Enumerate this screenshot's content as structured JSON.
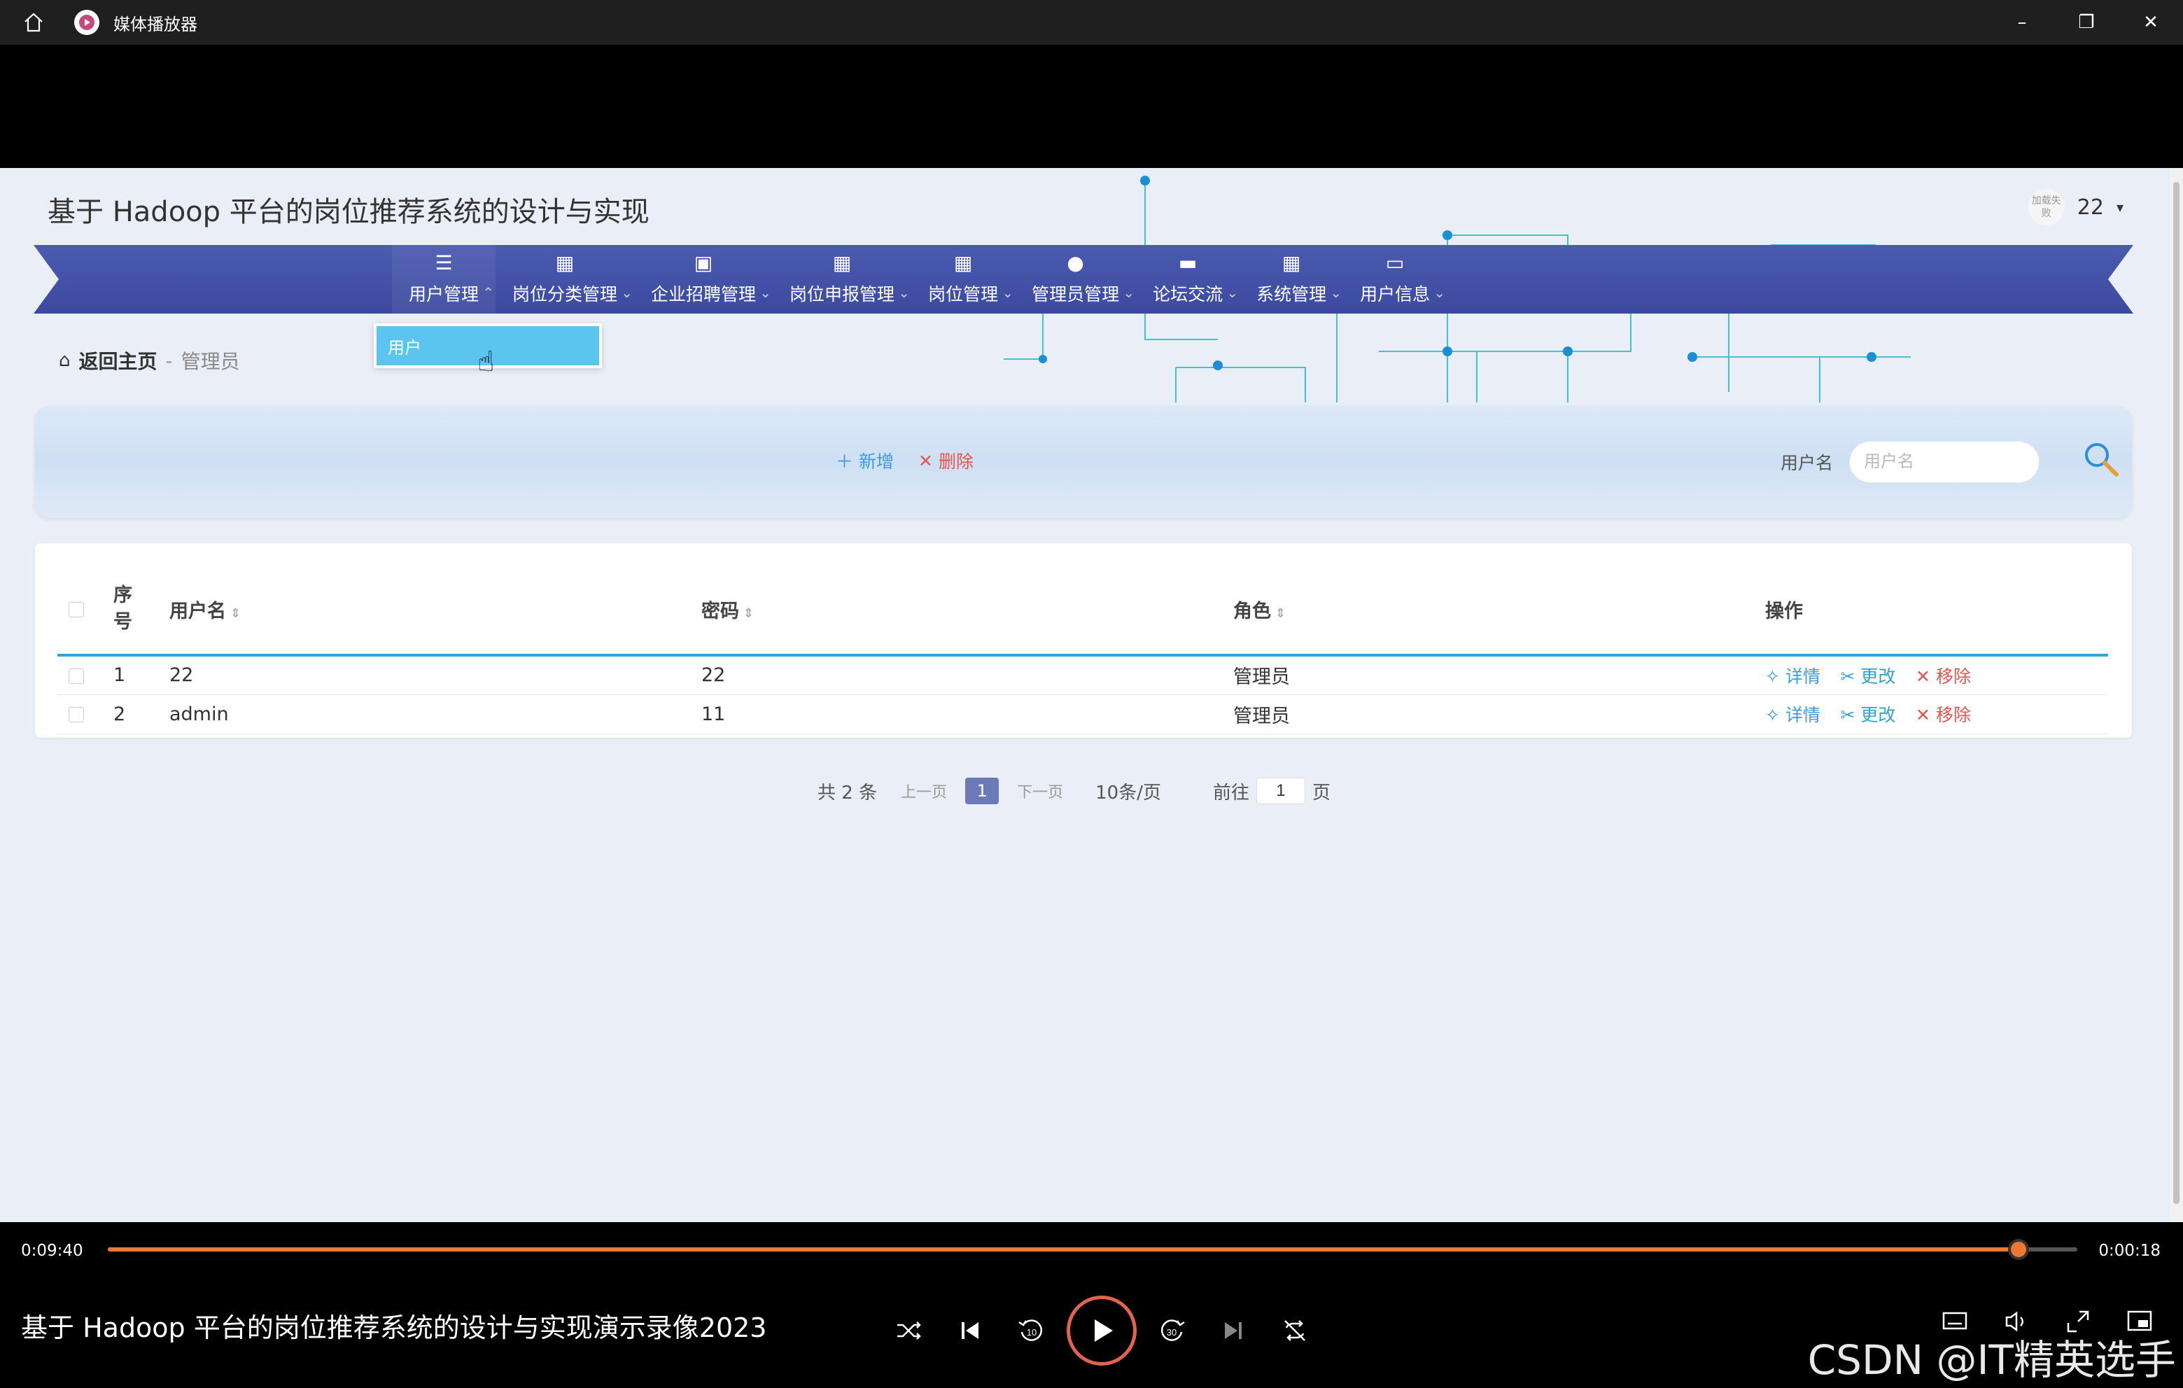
{
  "window": {
    "title": "媒体播放器"
  },
  "site": {
    "title": "基于 Hadoop 平台的岗位推荐系统的设计与实现",
    "user": {
      "avatar_text": "加载失败",
      "name": "22"
    }
  },
  "nav": {
    "items": [
      {
        "label": "用户管理",
        "icon": "list-icon",
        "arrow": "⌃"
      },
      {
        "label": "岗位分类管理",
        "icon": "grid-icon",
        "arrow": "⌄"
      },
      {
        "label": "企业招聘管理",
        "icon": "clipboard-icon",
        "arrow": "⌄"
      },
      {
        "label": "岗位申报管理",
        "icon": "grid-icon",
        "arrow": "⌄"
      },
      {
        "label": "岗位管理",
        "icon": "grid-icon",
        "arrow": "⌄"
      },
      {
        "label": "管理员管理",
        "icon": "bulb-icon",
        "arrow": "⌄"
      },
      {
        "label": "论坛交流",
        "icon": "chat-icon",
        "arrow": "⌄"
      },
      {
        "label": "系统管理",
        "icon": "grid-icon",
        "arrow": "⌄"
      },
      {
        "label": "用户信息",
        "icon": "card-icon",
        "arrow": "⌄"
      }
    ],
    "dropdown": {
      "item": "用户"
    }
  },
  "breadcrumb": {
    "home": "返回主页",
    "sep": "-",
    "current": "管理员"
  },
  "toolbar": {
    "add_label": "新增",
    "delete_label": "删除",
    "search_label": "用户名",
    "search_placeholder": "用户名"
  },
  "table": {
    "headers": {
      "index": "序号",
      "username": "用户名",
      "password": "密码",
      "role": "角色",
      "actions": "操作"
    },
    "rows": [
      {
        "index": "1",
        "username": "22",
        "password": "22",
        "role": "管理员"
      },
      {
        "index": "2",
        "username": "admin",
        "password": "11",
        "role": "管理员"
      }
    ],
    "ops": {
      "detail": "详情",
      "edit": "更改",
      "remove": "移除"
    }
  },
  "pager": {
    "total": "共 2 条",
    "prev": "上一页",
    "current": "1",
    "next": "下一页",
    "page_size": "10条/页",
    "goto_label": "前往",
    "goto_value": "1",
    "goto_suffix": "页"
  },
  "player": {
    "current_time": "0:09:40",
    "remaining_time": "0:00:18",
    "progress": 0.97,
    "video_title": "基于 Hadoop 平台的岗位推荐系统的设计与实现演示录像2023",
    "accent_color": "#f0772f"
  },
  "watermark": "CSDN @IT精英选手"
}
